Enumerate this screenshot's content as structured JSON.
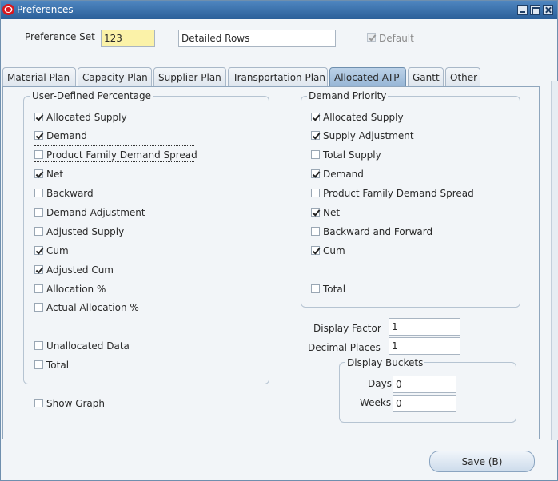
{
  "window": {
    "title": "Preferences"
  },
  "header": {
    "preference_set_label": "Preference Set",
    "preference_set_value": "123",
    "description_value": "Detailed Rows",
    "default_label": "Default",
    "default_checked": true
  },
  "tabs": [
    {
      "label": "Material Plan",
      "active": false
    },
    {
      "label": "Capacity Plan",
      "active": false
    },
    {
      "label": "Supplier Plan",
      "active": false
    },
    {
      "label": "Transportation Plan",
      "active": false
    },
    {
      "label": "Allocated ATP",
      "active": true
    },
    {
      "label": "Gantt",
      "active": false
    },
    {
      "label": "Other",
      "active": false
    }
  ],
  "user_defined": {
    "title": "User-Defined Percentage",
    "items": [
      {
        "label": "Allocated Supply",
        "checked": true
      },
      {
        "label": "Demand",
        "checked": true
      },
      {
        "label": "Product Family Demand Spread",
        "checked": false
      },
      {
        "label": "Net",
        "checked": true
      },
      {
        "label": "Backward",
        "checked": false
      },
      {
        "label": "Demand Adjustment",
        "checked": false
      },
      {
        "label": "Adjusted Supply",
        "checked": false
      },
      {
        "label": "Cum",
        "checked": true
      },
      {
        "label": "Adjusted Cum",
        "checked": true
      },
      {
        "label": "Allocation %",
        "checked": false
      },
      {
        "label": "Actual Allocation %",
        "checked": false
      },
      {
        "label": "Unallocated Data",
        "checked": false
      },
      {
        "label": "Total",
        "checked": false
      }
    ]
  },
  "show_graph": {
    "label": "Show Graph",
    "checked": false
  },
  "demand_priority": {
    "title": "Demand Priority",
    "items": [
      {
        "label": "Allocated Supply",
        "checked": true
      },
      {
        "label": "Supply Adjustment",
        "checked": true
      },
      {
        "label": "Total Supply",
        "checked": false
      },
      {
        "label": "Demand",
        "checked": true
      },
      {
        "label": "Product Family Demand Spread",
        "checked": false
      },
      {
        "label": "Net",
        "checked": true
      },
      {
        "label": "Backward and Forward",
        "checked": false
      },
      {
        "label": "Cum",
        "checked": true
      },
      {
        "label": "Total",
        "checked": false
      }
    ]
  },
  "display": {
    "factor_label": "Display Factor",
    "factor_value": "1",
    "decimal_label": "Decimal Places",
    "decimal_value": "1",
    "buckets_title": "Display Buckets",
    "days_label": "Days",
    "days_value": "0",
    "weeks_label": "Weeks",
    "weeks_value": "0"
  },
  "save_button": {
    "label": "Save (B)"
  }
}
